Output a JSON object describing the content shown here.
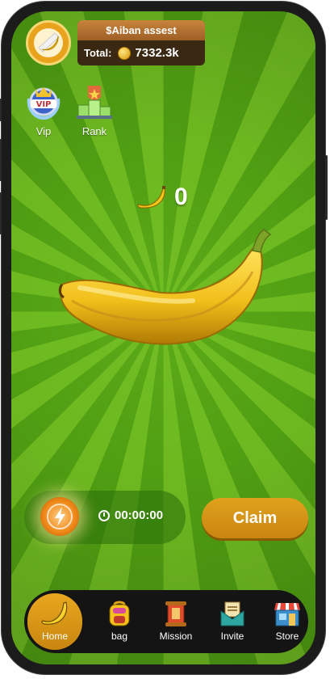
{
  "header": {
    "asset_title": "$Aiban assest",
    "total_label": "Total:",
    "total_value": "7332.3k"
  },
  "top_icons": [
    {
      "label": "Vip",
      "icon": "vip-badge-icon"
    },
    {
      "label": "Rank",
      "icon": "podium-icon"
    }
  ],
  "counter": {
    "value": "0",
    "icon": "banana-icon"
  },
  "timer": {
    "value": "00:00:00"
  },
  "claim_label": "Claim",
  "nav": [
    {
      "label": "Home",
      "icon": "banana-icon",
      "active": true
    },
    {
      "label": "bag",
      "icon": "backpack-icon"
    },
    {
      "label": "Mission",
      "icon": "scroll-icon"
    },
    {
      "label": "Invite",
      "icon": "mail-icon"
    },
    {
      "label": "Store",
      "icon": "store-icon"
    }
  ],
  "colors": {
    "accent": "#d9981a",
    "background": "#5caa18",
    "nav_bg": "#141414"
  }
}
